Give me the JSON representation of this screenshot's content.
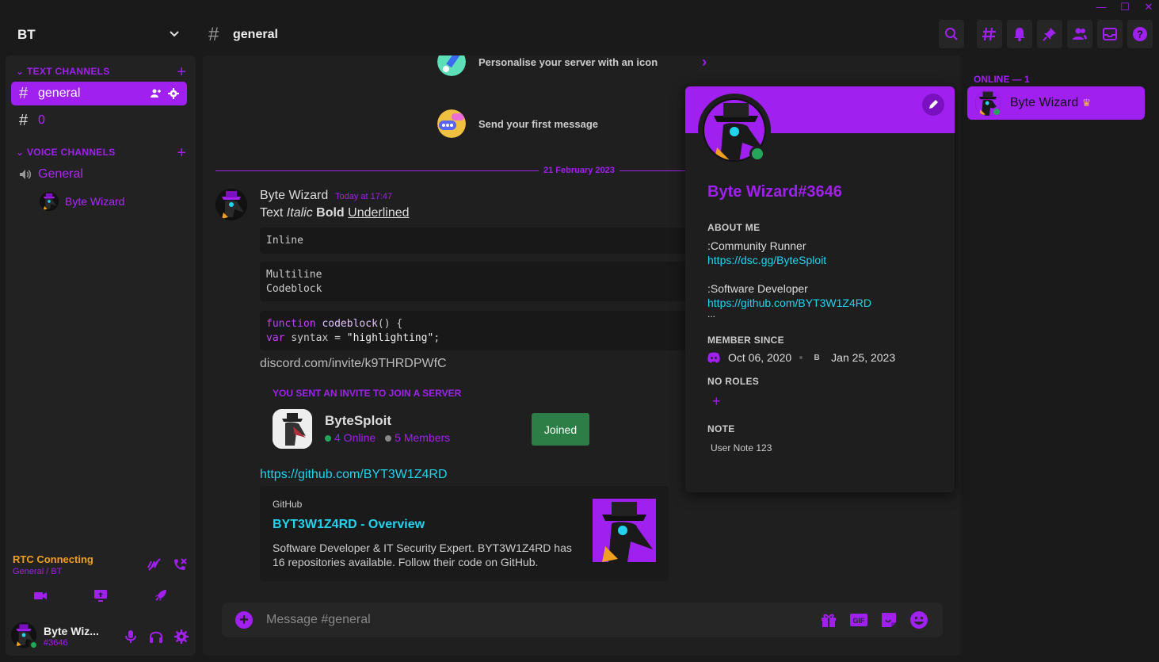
{
  "window_controls": {
    "minimize": "minimize-icon",
    "maximize": "maximize-icon",
    "close": "close-icon"
  },
  "server": {
    "name": "BT"
  },
  "channel_header": {
    "hash": "#",
    "name": "general"
  },
  "sidebar": {
    "text_category": "TEXT CHANNELS",
    "text_channels": [
      {
        "hash": "#",
        "label": "general",
        "active": true
      },
      {
        "hash": "#",
        "label": "0",
        "active": false
      }
    ],
    "voice_category": "VOICE CHANNELS",
    "voice_channels": [
      {
        "label": "General"
      }
    ],
    "voice_users": [
      {
        "label": "Byte Wizard"
      }
    ]
  },
  "rtc": {
    "status": "RTC Connecting",
    "location": "General / BT"
  },
  "user_panel": {
    "name": "Byte Wiz...",
    "discriminator": "#3646"
  },
  "welcome": {
    "item1": "Personalise your server with an icon",
    "item2": "Send your first message"
  },
  "divider_date": "21 February 2023",
  "message": {
    "author": "Byte Wizard",
    "timestamp": "Today at 17:47",
    "text_plain": "Text",
    "text_italic": "Italic",
    "text_bold": "Bold",
    "text_underlined": "Underlined",
    "code_inline": "Inline",
    "code_multi_1": "Multiline",
    "code_multi_2": "Codeblock",
    "code_syntax": {
      "kw1": "function",
      "fn": "codeblock",
      "rest1": "() {",
      "kw2": "var",
      "var": "syntax",
      "eq": "=",
      "str": "\"highlighting\"",
      "end": ";"
    },
    "invite_link": "discord.com/invite/k9THRDPWfC",
    "invite": {
      "title": "YOU SENT AN INVITE TO JOIN A SERVER",
      "server": "ByteSploit",
      "online": "4 Online",
      "members": "5 Members",
      "button": "Joined"
    },
    "github_link": "https://github.com/BYT3W1Z4RD",
    "embed": {
      "provider": "GitHub",
      "title": "BYT3W1Z4RD - Overview",
      "description": "Software Developer & IT Security Expert. BYT3W1Z4RD has 16 repositories available. Follow their code on GitHub."
    }
  },
  "composer": {
    "placeholder": "Message #general",
    "plus": "+"
  },
  "profile": {
    "tag": "Byte Wizard#3646",
    "about_label": "ABOUT ME",
    "about_1": ":Community Runner",
    "about_link_1": "https://dsc.gg/ByteSploit",
    "about_2": ":Software Developer",
    "about_link_2": "https://github.com/BYT3W1Z4RD",
    "about_more": "...",
    "member_since_label": "MEMBER SINCE",
    "discord_date": "Oct 06, 2020",
    "server_initial": "B",
    "server_date": "Jan 25, 2023",
    "roles_label": "NO ROLES",
    "roles_add": "+",
    "note_label": "NOTE",
    "note": "User Note 123"
  },
  "member_list": {
    "header": "ONLINE — 1",
    "members": [
      {
        "name": "Byte Wizard",
        "crown": "♛"
      }
    ]
  },
  "colors": {
    "accent": "#a020f0",
    "link": "#22d3ee",
    "rtc": "#f0a020",
    "joined": "#2d7d46",
    "online": "#23a55a"
  }
}
